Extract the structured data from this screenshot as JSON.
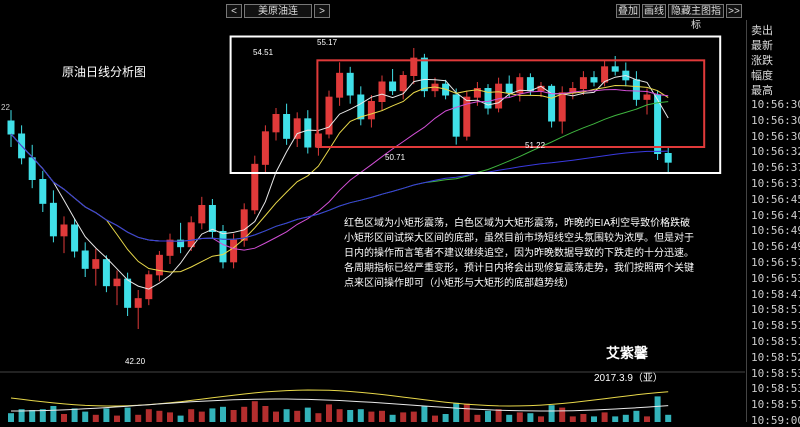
{
  "toolbar": {
    "prev_label": "<",
    "symbol": "美原油连",
    "next_label": ">",
    "overlay_label": "叠加",
    "draw_label": "画线",
    "hide_indicator_label": "隐藏主图指标",
    "expand_label": ">>"
  },
  "side_panel": {
    "labels": [
      "卖出",
      "最新",
      "涨跌",
      "幅度",
      "最高"
    ],
    "times": [
      "10:56:30",
      "10:56:30",
      "10:56:30",
      "10:56:32",
      "10:56:37",
      "10:56:37",
      "10:56:45",
      "10:56:47",
      "10:56:49",
      "10:56:49",
      "10:56:51",
      "10:56:53",
      "10:58:47",
      "10:58:51",
      "10:58:51",
      "10:58:51",
      "10:58:52",
      "10:58:53",
      "10:58:53",
      "10:58:57",
      "10:59:00"
    ]
  },
  "chart_data": {
    "type": "candlestick",
    "title": "原油日线分析图",
    "price_labels": {
      "left_edge": "22",
      "high_in_white": "54.51",
      "top_peak": "55.17",
      "red_box_low_left": "50.71",
      "red_box_low_right": "51.22",
      "major_low": "42.20"
    },
    "ylim": [
      41,
      56
    ],
    "candles": [
      {
        "o": 51.8,
        "h": 52.3,
        "l": 50.6,
        "c": 51.2
      },
      {
        "o": 51.2,
        "h": 51.6,
        "l": 49.8,
        "c": 50.1
      },
      {
        "o": 50.1,
        "h": 50.7,
        "l": 48.7,
        "c": 49.1
      },
      {
        "o": 49.1,
        "h": 49.5,
        "l": 47.6,
        "c": 48.0
      },
      {
        "o": 48.0,
        "h": 48.6,
        "l": 46.2,
        "c": 46.5
      },
      {
        "o": 46.5,
        "h": 47.4,
        "l": 45.7,
        "c": 47.0
      },
      {
        "o": 47.0,
        "h": 47.3,
        "l": 45.5,
        "c": 45.8
      },
      {
        "o": 45.8,
        "h": 46.2,
        "l": 44.6,
        "c": 45.0
      },
      {
        "o": 45.0,
        "h": 45.9,
        "l": 44.2,
        "c": 45.4
      },
      {
        "o": 45.4,
        "h": 45.6,
        "l": 43.9,
        "c": 44.2
      },
      {
        "o": 44.2,
        "h": 44.9,
        "l": 43.3,
        "c": 44.5
      },
      {
        "o": 44.5,
        "h": 44.8,
        "l": 42.8,
        "c": 43.2
      },
      {
        "o": 43.2,
        "h": 44.0,
        "l": 42.2,
        "c": 43.6
      },
      {
        "o": 43.6,
        "h": 44.9,
        "l": 43.3,
        "c": 44.7
      },
      {
        "o": 44.7,
        "h": 45.8,
        "l": 44.4,
        "c": 45.6
      },
      {
        "o": 45.6,
        "h": 46.6,
        "l": 45.2,
        "c": 46.3
      },
      {
        "o": 46.3,
        "h": 47.1,
        "l": 45.7,
        "c": 46.0
      },
      {
        "o": 46.0,
        "h": 47.4,
        "l": 45.8,
        "c": 47.1
      },
      {
        "o": 47.1,
        "h": 48.3,
        "l": 46.8,
        "c": 47.9
      },
      {
        "o": 47.9,
        "h": 48.2,
        "l": 46.4,
        "c": 46.7
      },
      {
        "o": 46.7,
        "h": 47.0,
        "l": 45.0,
        "c": 45.3
      },
      {
        "o": 45.3,
        "h": 46.6,
        "l": 45.0,
        "c": 46.3
      },
      {
        "o": 46.3,
        "h": 48.0,
        "l": 46.0,
        "c": 47.7
      },
      {
        "o": 47.7,
        "h": 50.2,
        "l": 47.5,
        "c": 49.8
      },
      {
        "o": 49.8,
        "h": 51.6,
        "l": 49.4,
        "c": 51.3
      },
      {
        "o": 51.3,
        "h": 52.4,
        "l": 50.9,
        "c": 52.1
      },
      {
        "o": 52.1,
        "h": 52.6,
        "l": 50.7,
        "c": 51.0
      },
      {
        "o": 51.0,
        "h": 52.2,
        "l": 50.6,
        "c": 51.9
      },
      {
        "o": 51.9,
        "h": 52.3,
        "l": 50.3,
        "c": 50.6
      },
      {
        "o": 50.6,
        "h": 51.4,
        "l": 50.2,
        "c": 51.2
      },
      {
        "o": 51.2,
        "h": 53.2,
        "l": 51.0,
        "c": 52.9
      },
      {
        "o": 52.9,
        "h": 54.51,
        "l": 52.5,
        "c": 54.0
      },
      {
        "o": 54.0,
        "h": 54.3,
        "l": 52.6,
        "c": 53.0
      },
      {
        "o": 53.0,
        "h": 53.4,
        "l": 51.6,
        "c": 51.9
      },
      {
        "o": 51.9,
        "h": 53.0,
        "l": 51.5,
        "c": 52.7
      },
      {
        "o": 52.7,
        "h": 53.9,
        "l": 52.3,
        "c": 53.6
      },
      {
        "o": 53.6,
        "h": 54.2,
        "l": 53.0,
        "c": 53.2
      },
      {
        "o": 53.2,
        "h": 54.1,
        "l": 52.8,
        "c": 53.9
      },
      {
        "o": 53.9,
        "h": 55.17,
        "l": 53.5,
        "c": 54.7
      },
      {
        "o": 54.7,
        "h": 54.9,
        "l": 52.9,
        "c": 53.2
      },
      {
        "o": 53.2,
        "h": 53.8,
        "l": 52.9,
        "c": 53.5
      },
      {
        "o": 53.5,
        "h": 53.7,
        "l": 52.8,
        "c": 53.0
      },
      {
        "o": 53.0,
        "h": 53.3,
        "l": 50.71,
        "c": 51.1
      },
      {
        "o": 51.1,
        "h": 53.2,
        "l": 50.9,
        "c": 52.9
      },
      {
        "o": 52.9,
        "h": 53.6,
        "l": 52.5,
        "c": 53.3
      },
      {
        "o": 53.3,
        "h": 53.5,
        "l": 52.1,
        "c": 52.4
      },
      {
        "o": 52.4,
        "h": 53.8,
        "l": 52.2,
        "c": 53.5
      },
      {
        "o": 53.5,
        "h": 53.9,
        "l": 52.9,
        "c": 53.1
      },
      {
        "o": 53.1,
        "h": 54.0,
        "l": 52.7,
        "c": 53.8
      },
      {
        "o": 53.8,
        "h": 54.0,
        "l": 53.0,
        "c": 53.2
      },
      {
        "o": 53.2,
        "h": 53.6,
        "l": 52.9,
        "c": 53.4
      },
      {
        "o": 53.4,
        "h": 53.5,
        "l": 51.5,
        "c": 51.8
      },
      {
        "o": 51.8,
        "h": 53.4,
        "l": 51.22,
        "c": 53.1
      },
      {
        "o": 53.1,
        "h": 53.6,
        "l": 52.8,
        "c": 53.3
      },
      {
        "o": 53.3,
        "h": 54.1,
        "l": 53.0,
        "c": 53.8
      },
      {
        "o": 53.8,
        "h": 54.1,
        "l": 53.4,
        "c": 53.6
      },
      {
        "o": 53.6,
        "h": 54.6,
        "l": 53.4,
        "c": 54.3
      },
      {
        "o": 54.3,
        "h": 54.8,
        "l": 53.9,
        "c": 54.1
      },
      {
        "o": 54.1,
        "h": 54.5,
        "l": 53.4,
        "c": 53.7
      },
      {
        "o": 53.7,
        "h": 54.1,
        "l": 52.5,
        "c": 52.8
      },
      {
        "o": 52.8,
        "h": 53.3,
        "l": 52.1,
        "c": 53.0
      },
      {
        "o": 53.0,
        "h": 53.2,
        "l": 50.0,
        "c": 50.3
      },
      {
        "o": 50.3,
        "h": 50.6,
        "l": 49.4,
        "c": 49.9
      }
    ],
    "moving_averages": [
      {
        "period": 5,
        "color": "#e8e8e8"
      },
      {
        "period": 10,
        "color": "#e8d84a"
      },
      {
        "period": 20,
        "color": "#d24fd6"
      },
      {
        "period": 40,
        "color": "#3fb53f"
      },
      {
        "period": 60,
        "color": "#3a3ae0"
      }
    ],
    "annotation_lines": [
      "红色区域为小矩形震荡，白色区域为大矩形震荡，昨晚的EIA利空导致价格跌破",
      "小矩形区间试探大区间的底部，虽然目前市场短线空头氛围较为浓厚。但是对于",
      "日内的操作而言笔者不建议继续追空，因为昨晚数据导致的下跌走的十分迅速。",
      "各周期指标已经严重变形，预计日内将会出现修复震荡走势，我们按照两个关键",
      "点来区间操作即可（小矩形与大矩形的底部趋势线）"
    ],
    "author": "艾紫馨",
    "date": "2017.3.9（亚）",
    "colors": {
      "up": "#e03a3a",
      "down": "#40e0e8",
      "white_box": "#ffffff",
      "red_box": "#e03a3a"
    }
  }
}
